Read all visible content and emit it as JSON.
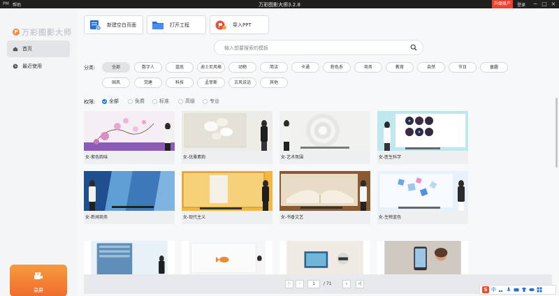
{
  "titlebar": {
    "logo_mini": "PM",
    "help": "帮助",
    "title": "万彩图影大师3.2.8",
    "vip": "升级账户",
    "login": "登录"
  },
  "sidebar": {
    "brand": "万彩图影大师",
    "brand_badge": "P",
    "items": [
      {
        "label": "首页",
        "icon": "home-icon"
      },
      {
        "label": "最近使用",
        "icon": "clock-icon"
      }
    ],
    "record_label": "录屏"
  },
  "toolbar": {
    "new_blank": "新建空白页面",
    "open_project": "打开工程",
    "import_ppt": "导入PPT"
  },
  "search": {
    "placeholder": "输入想要搜索的模板"
  },
  "categories": {
    "label": "分类:",
    "row1": [
      "全部",
      "数字人",
      "蓝底",
      "迪士尼风格",
      "动物",
      "简洁",
      "卡通",
      "粉色系",
      "商务",
      "教育",
      "自然",
      "节日",
      "童趣"
    ],
    "row2": [
      "国风",
      "党建",
      "科技",
      "孟菲斯",
      "古风说话",
      "其他"
    ],
    "active": "全部"
  },
  "permission": {
    "label": "权限:",
    "options": [
      "全部",
      "免费",
      "标准",
      "高级",
      "专业"
    ],
    "selected": "全部"
  },
  "templates": [
    {
      "name": "女-紫色韵味",
      "thumb": "purple-flowers"
    },
    {
      "name": "女-优雅素韵",
      "thumb": "white-orchid"
    },
    {
      "name": "女-艺术氛围",
      "thumb": "white-spiral"
    },
    {
      "name": "女-医生科学",
      "thumb": "teal-science"
    },
    {
      "name": "女-新闻商务",
      "thumb": "blue-buildings"
    },
    {
      "name": "女-现代主义",
      "thumb": "orange-frame"
    },
    {
      "name": "女-书香文艺",
      "thumb": "book"
    },
    {
      "name": "女-生物蓝色",
      "thumb": "blue-cubes"
    },
    {
      "name": "",
      "thumb": "building"
    },
    {
      "name": "",
      "thumb": "goldfish"
    },
    {
      "name": "",
      "thumb": "robot"
    },
    {
      "name": "",
      "thumb": "phone"
    }
  ],
  "pagination": {
    "current": "1",
    "total": "/ 71"
  },
  "ime": {
    "lang": "中"
  },
  "colors": {
    "accent": "#1e6fd9",
    "vip": "#e8432e",
    "record_start": "#f59a3d",
    "record_end": "#f06d2c"
  }
}
